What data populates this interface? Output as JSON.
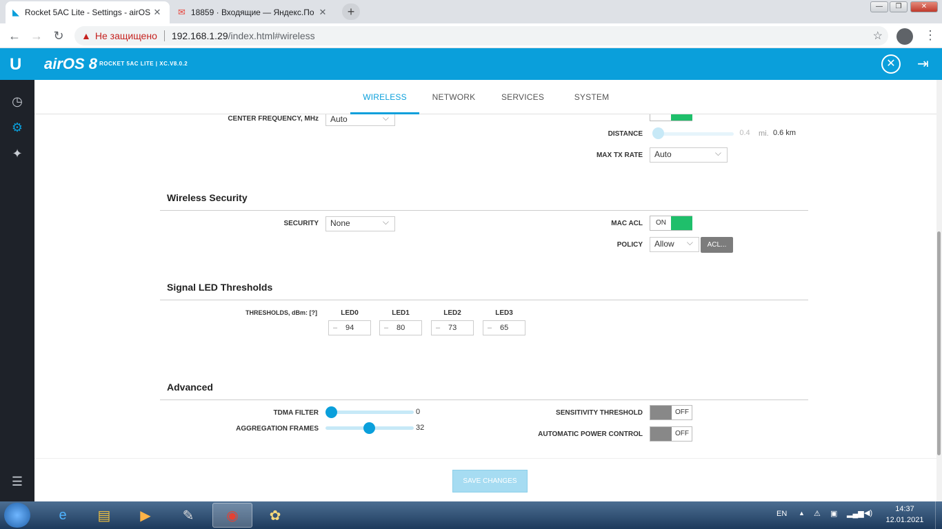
{
  "browser": {
    "tabs": [
      {
        "title": "Rocket 5AC Lite - Settings - airOS",
        "active": true
      },
      {
        "title": "18859 · Входящие — Яндекс.По",
        "active": false
      }
    ],
    "new_tab": "+",
    "security_label": "Не защищено",
    "url_host": "192.168.1.29",
    "url_path": "/index.html#wireless"
  },
  "app": {
    "logo": "U",
    "brand": "airOS 8",
    "device": "ROCKET 5AC LITE | XC.V8.0.2"
  },
  "nav": {
    "tabs": [
      {
        "label": "WIRELESS",
        "active": true
      },
      {
        "label": "NETWORK",
        "active": false
      },
      {
        "label": "SERVICES",
        "active": false
      },
      {
        "label": "SYSTEM",
        "active": false
      }
    ]
  },
  "wireless": {
    "center_frequency_label": "CENTER FREQUENCY, MHz",
    "center_frequency_value": "Auto",
    "distance_label": "DISTANCE",
    "distance_value": "0.4",
    "distance_unit": "mi.",
    "distance_km": "0.6 km",
    "max_tx_rate_label": "MAX TX RATE",
    "max_tx_rate_value": "Auto"
  },
  "security": {
    "title": "Wireless Security",
    "security_label": "SECURITY",
    "security_value": "None",
    "mac_acl_label": "MAC ACL",
    "mac_acl_state": "ON",
    "policy_label": "POLICY",
    "policy_value": "Allow",
    "acl_button": "ACL..."
  },
  "led": {
    "title": "Signal LED Thresholds",
    "thresholds_label": "THRESHOLDS, dBm: [?]",
    "leds": [
      {
        "name": "LED0",
        "value": "94"
      },
      {
        "name": "LED1",
        "value": "80"
      },
      {
        "name": "LED2",
        "value": "73"
      },
      {
        "name": "LED3",
        "value": "65"
      }
    ],
    "minus": "–"
  },
  "advanced": {
    "title": "Advanced",
    "tdma_filter_label": "TDMA FILTER",
    "tdma_filter_value": "0",
    "aggregation_frames_label": "AGGREGATION FRAMES",
    "aggregation_frames_value": "32",
    "sensitivity_threshold_label": "SENSITIVITY THRESHOLD",
    "sensitivity_threshold_state": "OFF",
    "auto_power_label": "AUTOMATIC POWER CONTROL",
    "auto_power_state": "OFF"
  },
  "save_button": "SAVE CHANGES",
  "taskbar": {
    "lang": "EN",
    "time": "14:37",
    "date": "12.01.2021"
  },
  "colors": {
    "accent": "#0a9fdb",
    "toggle_on": "#1fbf6b",
    "toggle_off": "#888888"
  }
}
